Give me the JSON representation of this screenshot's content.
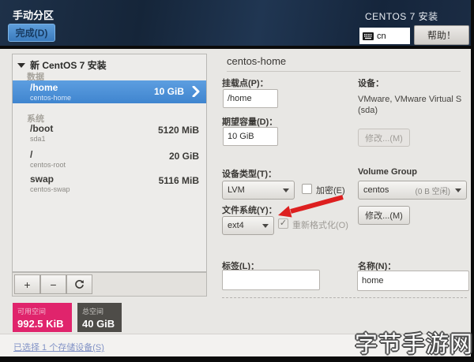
{
  "topbar": {
    "title": "手动分区",
    "done": "完成(D)",
    "product": "CENTOS 7 安装",
    "keyboard_layout": "cn",
    "help": "帮助！"
  },
  "sidebar": {
    "root_label": "新 CentOS 7 安装",
    "section_data": "数据",
    "section_system": "系统",
    "rows": [
      {
        "mount": "/home",
        "sub": "centos-home",
        "size": "10 GiB"
      },
      {
        "mount": "/boot",
        "sub": "sda1",
        "size": "5120 MiB"
      },
      {
        "mount": "/",
        "sub": "centos-root",
        "size": "20 GiB"
      },
      {
        "mount": "swap",
        "sub": "centos-swap",
        "size": "5116 MiB"
      }
    ],
    "toolbar": {
      "add": "+",
      "remove": "−"
    },
    "available_label": "可用空间",
    "available_value": "992.5 KiB",
    "total_label": "总空间",
    "total_value": "40 GiB",
    "storage_link": "已选择 1 个存储设备(S)"
  },
  "details": {
    "title": "centos-home",
    "mount_label": "挂载点(P)：",
    "mount_value": "/home",
    "device_label": "设备：",
    "device_value": "VMware, VMware Virtual S (sda)",
    "capacity_label": "期望容量(D)：",
    "capacity_value": "10 GiB",
    "modify_disabled": "修改...(M)",
    "devtype_label": "设备类型(T)：",
    "devtype_value": "LVM",
    "encrypt_label": "加密(E)",
    "vg_label": "Volume Group",
    "vg_value": "centos",
    "vg_free": "(0 B 空闲)",
    "modify_enabled": "修改...(M)",
    "fs_label": "文件系统(Y)：",
    "fs_value": "ext4",
    "reformat_label": "重新格式化(O)",
    "label_label": "标签(L)：",
    "label_value": "",
    "name_label": "名称(N)：",
    "name_value": "home"
  },
  "icons": {
    "check": "✓"
  },
  "colors": {
    "accent": "#4a90d9",
    "available": "#e0246c",
    "total": "#4e4c48",
    "arrow": "#dd1f1f"
  },
  "watermark": "字节手游网"
}
